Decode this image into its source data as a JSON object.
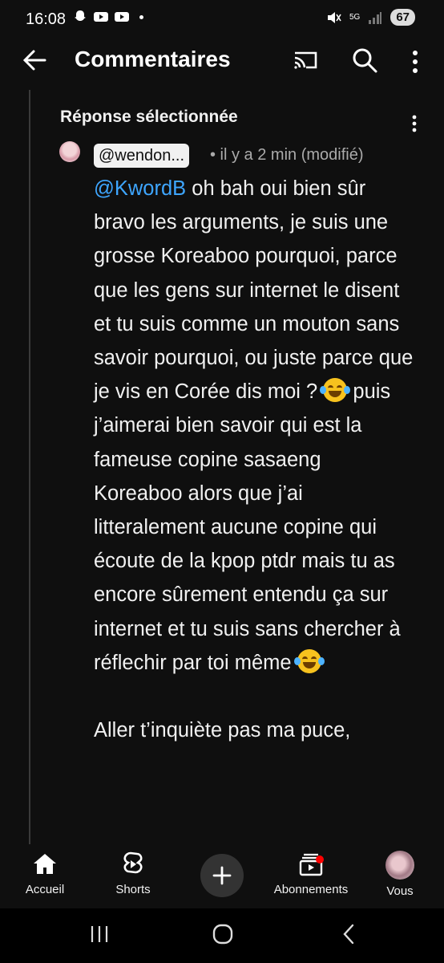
{
  "status_bar": {
    "time": "16:08",
    "network": "5G",
    "battery": "67"
  },
  "app_bar": {
    "title": "Commentaires"
  },
  "section": {
    "label": "Réponse sélectionnée"
  },
  "comment": {
    "author_handle": "@wendon...",
    "meta": "• il y a 2 min (modifié)",
    "mention": "@KwordB",
    "text_1": " oh bah oui bien sûr bravo les arguments, je suis une grosse Koreaboo pourquoi, parce que les gens sur internet le disent et tu suis comme un mouton sans savoir pourquoi, ou juste parce que je vis en Corée dis moi ?",
    "text_2": " puis j’aimerai bien savoir qui est la fameuse copine sasaeng Koreaboo alors que j’ai litteralement aucune copine qui écoute de la kpop ptdr mais tu as encore sûrement entendu ça sur internet et tu suis sans chercher à réflechir par toi même",
    "text_3": "Aller t’inquiète pas ma puce,",
    "emoji_name": "face-with-tears-of-joy"
  },
  "bottom_nav": {
    "items": [
      {
        "label": "Accueil",
        "icon": "home-icon"
      },
      {
        "label": "Shorts",
        "icon": "shorts-icon"
      },
      {
        "label": "",
        "icon": "create-icon"
      },
      {
        "label": "Abonnements",
        "icon": "subscriptions-icon"
      },
      {
        "label": "Vous",
        "icon": "avatar"
      }
    ]
  },
  "colors": {
    "background": "#0f0f0f",
    "mention": "#3ea6ff",
    "notification_dot": "#ff0000"
  }
}
